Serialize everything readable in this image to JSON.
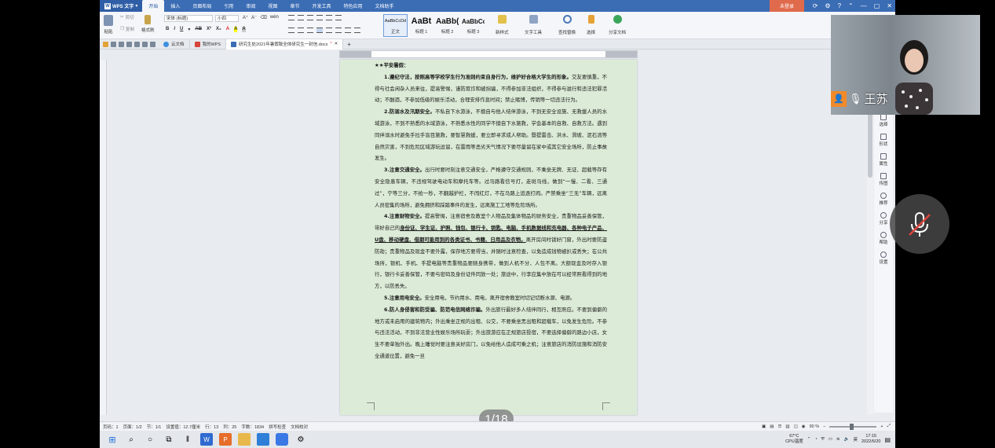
{
  "titlebar": {
    "app_name": "WPS 文字",
    "tabs": [
      "开始",
      "插入",
      "页面布局",
      "引用",
      "审阅",
      "视图",
      "章节",
      "开发工具",
      "特色应用",
      "文档助手"
    ],
    "login": "未登录"
  },
  "ribbon": {
    "paste": "粘贴",
    "cut": "剪切",
    "copy": "复制",
    "format_painter": "格式刷",
    "font_name": "宋体 (标题)",
    "font_size": "小四",
    "styles": [
      {
        "sample": "AaBbCcDd",
        "name": "正文"
      },
      {
        "sample": "AaBt",
        "name": "标题 1"
      },
      {
        "sample": "AaBb(",
        "name": "标题 2"
      },
      {
        "sample": "AaBbCc",
        "name": "标题 3"
      }
    ],
    "new_style": "新样式",
    "text_tools": "文字工具",
    "find_replace": "查找替换",
    "select": "选择",
    "share_doc": "分享文档"
  },
  "tabs": {
    "cloud": "云文档",
    "mywps": "我的WPS",
    "doc": "研究生处2021年暑假致全体研究生一封信.docx"
  },
  "document": {
    "heading": "★★平安暑假：",
    "p1_bold": "1.遵纪守法，按照高等学校学生行为准则约束自身行为，维护好合格大学生的形象。",
    "p1_rest": "交友要慎重，不得与社会闲杂人员来往，提高警惕，谨防欺诈和被拐骗，不得参加非法组织，不得参与滋行和违法犯罪活动；不酗酒，不参加低级的娱乐活动，合理安排作息时间；禁止赌博，传销等一切违法行为。",
    "p2_bold": "2.防溺水及汛期安全。",
    "p2_rest": "不私自下水游泳，不擅自与他人结伴游泳，不到无安全设施、无救援人员的水域游泳，不到不熟悉的水域游泳，不熟悉水性的同学不擅自下水施救，学会基本的自救、自救方法。遇到同伴溺水时避免手拉手盲目施救，要智慧救援，要立即寻求成人帮助。暨提雷击、洪水、滑坡、泥石流等自然灾害，不到危险区域游玩逗留，在雷雨等恶劣天气情况下要尽量留在家中或其它安全场所，防止事故发生。",
    "p3_bold": "3.注意交通安全。",
    "p3_rest": "出行时要时刻注意交通安全，严格遵守交通规则，不乘坐无牌、无证、超载等存有安全隐患车辆，不违规驾驶电动车和摩托车等。过马路看信号灯，走斑马线，做到“一慢、二看、三通过”，宁等三分，不抢一秒，不翻越护栏，不闯红灯，不在马路上追逐打闹。严禁乘坐“三无”车辆，远离人员密集的场所，避免拥挤和踩踏事件的发生，远离施工工地等危险场所。",
    "p4_bold": "4.注意财物安全。",
    "p4_mid": "提高警惕，注意宿舍及教室个人物品及集体物品的财务安全，贵重物品妥善保管，带好自己的",
    "p4_u": "身份证、学生证、护照、钱包、银行卡、钥匙、电脑、手机数据线和充电器、各种电子产品、U盘、移动硬盘、借期可能用到的各类证书、书籍、日用品及衣物。",
    "p4_rest": "离开房间时锁好门窗，外出时要防盗防劫；贵重物品及现金不要外露，保存地方要得当，并随时注意检查，以免造成钱物被扒或丢失；在公共场所，银机、手机、手提电脑等贵重物品要随身携带，做到人机不分、人包不离。大额现金及时存入银行，银行卡妥善保管，不要与密码及身份证件同放一处；旅途中，行李应集中放在可以经常照看得到的地方，以防丢失。",
    "p5_bold": "5.注意用电安全。",
    "p5_rest": "安全用电，节约用水、用电，离开宿舍教室时切记切断水源、电源。",
    "p6_bold": "6.防人身侵害和防受骗、防范电信网络诈骗。",
    "p6_rest": "外出旅行最好多人结伴同行，相互照应。不要到偏僻的地方或未启用的建筑物内；外出乘坐正规的出租、公交，不要乘坐黑出租和超载车，以免发生危险。不参与违法活动，不到非法营业性娱乐场所玩耍；外出旅游应在正规旅店投宿，不要选择偏僻的路边小店，女生不要单独外出。晚上睡觉时要注意关好房门，以免给他人造成可乘之机；注意旅店的消防设施和消防安全通道位置，避免一旦"
  },
  "page_counter": "1/18",
  "statusbar": {
    "page_num": "页码：1",
    "pages": "页面：1/2",
    "section": "节：1/1",
    "position": "设置值：12.7厘米",
    "line": "行：13",
    "col": "列：25",
    "words": "字数：1834",
    "spell": "拼写检查",
    "proofread": "文档校对",
    "zoom": "90 %"
  },
  "right_panel": [
    "选择",
    "形状",
    "属性",
    "传图",
    "推荐",
    "分享",
    "帮助",
    "设置"
  ],
  "taskbar": {
    "weather": "67°C",
    "weather_label": "CPU温度",
    "ime": "英",
    "time": "17:15",
    "date": "2022/6/20"
  },
  "video": {
    "name": "王苏"
  }
}
